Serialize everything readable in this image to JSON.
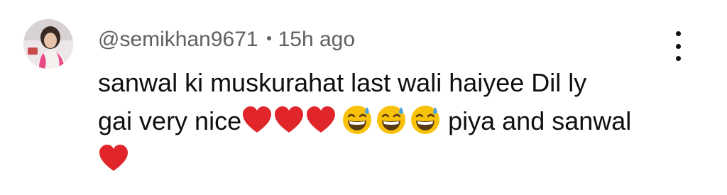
{
  "comment": {
    "author": "@semikhan9671",
    "time": "15h ago",
    "line1": "sanwal ki muskurahat last wali haiyee Dil ly",
    "line2_text": "gai very nice",
    "line2_tail": "piya and sanwal",
    "emoji": [
      "red-heart",
      "red-heart",
      "red-heart",
      "grinning-sweat",
      "grinning-sweat",
      "grinning-sweat",
      "red-heart"
    ]
  },
  "colors": {
    "heart": "#e0262b",
    "meta_text": "#606060",
    "body_text": "#0f0f0f",
    "smile_face": "#f9c20a"
  },
  "icons": {
    "more": "three-dots-vertical-icon"
  }
}
